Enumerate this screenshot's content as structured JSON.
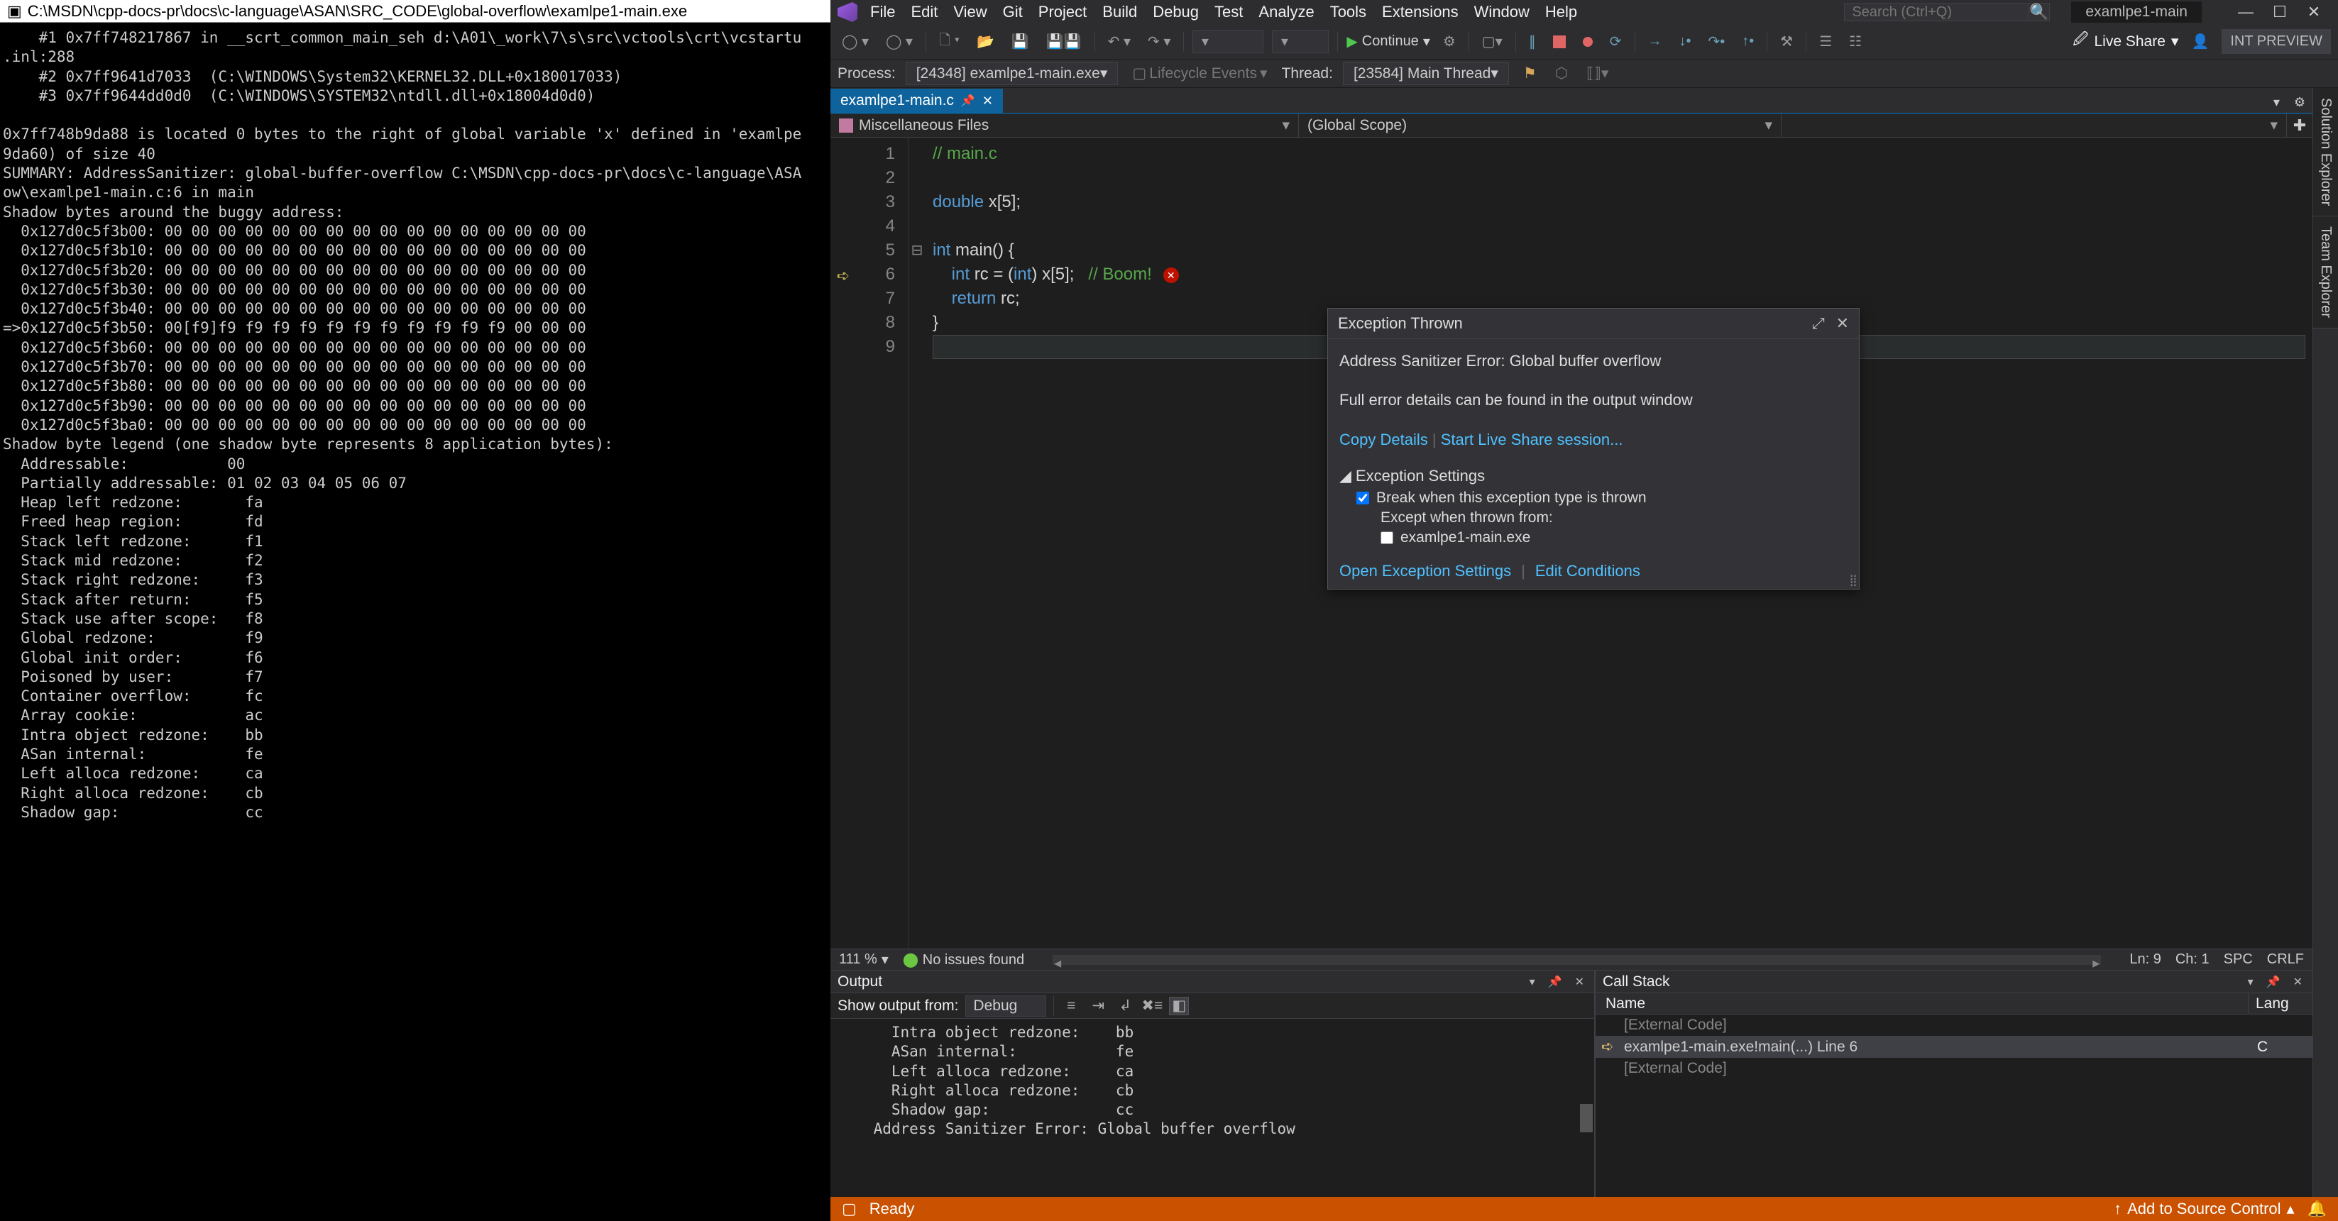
{
  "console": {
    "title": " C:\\MSDN\\cpp-docs-pr\\docs\\c-language\\ASAN\\SRC_CODE\\global-overflow\\examlpe1-main.exe",
    "body": "    #1 0x7ff748217867 in __scrt_common_main_seh d:\\A01\\_work\\7\\s\\src\\vctools\\crt\\vcstartu\n.inl:288\n    #2 0x7ff9641d7033  (C:\\WINDOWS\\System32\\KERNEL32.DLL+0x180017033)\n    #3 0x7ff9644dd0d0  (C:\\WINDOWS\\SYSTEM32\\ntdll.dll+0x18004d0d0)\n\n0x7ff748b9da88 is located 0 bytes to the right of global variable 'x' defined in 'examlpe\n9da60) of size 40\nSUMMARY: AddressSanitizer: global-buffer-overflow C:\\MSDN\\cpp-docs-pr\\docs\\c-language\\ASA\now\\examlpe1-main.c:6 in main\nShadow bytes around the buggy address:\n  0x127d0c5f3b00: 00 00 00 00 00 00 00 00 00 00 00 00 00 00 00 00\n  0x127d0c5f3b10: 00 00 00 00 00 00 00 00 00 00 00 00 00 00 00 00\n  0x127d0c5f3b20: 00 00 00 00 00 00 00 00 00 00 00 00 00 00 00 00\n  0x127d0c5f3b30: 00 00 00 00 00 00 00 00 00 00 00 00 00 00 00 00\n  0x127d0c5f3b40: 00 00 00 00 00 00 00 00 00 00 00 00 00 00 00 00\n=>0x127d0c5f3b50: 00[f9]f9 f9 f9 f9 f9 f9 f9 f9 f9 f9 f9 00 00 00\n  0x127d0c5f3b60: 00 00 00 00 00 00 00 00 00 00 00 00 00 00 00 00\n  0x127d0c5f3b70: 00 00 00 00 00 00 00 00 00 00 00 00 00 00 00 00\n  0x127d0c5f3b80: 00 00 00 00 00 00 00 00 00 00 00 00 00 00 00 00\n  0x127d0c5f3b90: 00 00 00 00 00 00 00 00 00 00 00 00 00 00 00 00\n  0x127d0c5f3ba0: 00 00 00 00 00 00 00 00 00 00 00 00 00 00 00 00\nShadow byte legend (one shadow byte represents 8 application bytes):\n  Addressable:           00\n  Partially addressable: 01 02 03 04 05 06 07\n  Heap left redzone:       fa\n  Freed heap region:       fd\n  Stack left redzone:      f1\n  Stack mid redzone:       f2\n  Stack right redzone:     f3\n  Stack after return:      f5\n  Stack use after scope:   f8\n  Global redzone:          f9\n  Global init order:       f6\n  Poisoned by user:        f7\n  Container overflow:      fc\n  Array cookie:            ac\n  Intra object redzone:    bb\n  ASan internal:           fe\n  Left alloca redzone:     ca\n  Right alloca redzone:    cb\n  Shadow gap:              cc"
  },
  "menu": {
    "items": [
      "File",
      "Edit",
      "View",
      "Git",
      "Project",
      "Build",
      "Debug",
      "Test",
      "Analyze",
      "Tools",
      "Extensions",
      "Window",
      "Help"
    ]
  },
  "search": {
    "placeholder": "Search (Ctrl+Q)"
  },
  "solution_name": "examlpe1-main",
  "toolbar": {
    "continue": "Continue",
    "live_share": "Live Share",
    "int_preview": "INT PREVIEW"
  },
  "procbar": {
    "process_label": "Process:",
    "process_value": "[24348] examlpe1-main.exe",
    "lifecycle": "Lifecycle Events",
    "thread_label": "Thread:",
    "thread_value": "[23584] Main Thread"
  },
  "file_tab": {
    "name": "examlpe1-main.c"
  },
  "navbar": {
    "left": "Miscellaneous Files",
    "middle": "(Global Scope)",
    "right": ""
  },
  "code": {
    "lines": [
      {
        "n": 1,
        "html": "<span class='cm'>// main.c</span>"
      },
      {
        "n": 2,
        "html": ""
      },
      {
        "n": 3,
        "html": "<span class='kw'>double</span> x[5];"
      },
      {
        "n": 4,
        "html": ""
      },
      {
        "n": 5,
        "html": "<span class='kw'>int</span> main() {",
        "fold": "⊟"
      },
      {
        "n": 6,
        "html": "    <span class='kw'>int</span> rc = (<span class='kw'>int</span>) x[5];   <span class='cm'>// Boom!</span>",
        "err": true
      },
      {
        "n": 7,
        "html": "    <span class='kw'>return</span> rc;"
      },
      {
        "n": 8,
        "html": "}"
      },
      {
        "n": 9,
        "html": "",
        "cur": true
      }
    ]
  },
  "exception": {
    "title": "Exception Thrown",
    "message": "Address Sanitizer Error: Global buffer overflow",
    "details_note": "Full error details can be found in the output window",
    "copy": "Copy Details",
    "start_live": "Start Live Share session...",
    "settings_header": "Exception Settings",
    "break_label": "Break when this exception type is thrown",
    "except_label": "Except when thrown from:",
    "except_item": "examlpe1-main.exe",
    "open_settings": "Open Exception Settings",
    "edit_cond": "Edit Conditions"
  },
  "edit_status": {
    "zoom": "111 %",
    "issues": "No issues found",
    "ln": "Ln: 9",
    "ch": "Ch: 1",
    "spc": "SPC",
    "crlf": "CRLF"
  },
  "output": {
    "title": "Output",
    "show_from": "Show output from:",
    "source": "Debug",
    "body": "      Intra object redzone:    bb\n      ASan internal:           fe\n      Left alloca redzone:     ca\n      Right alloca redzone:    cb\n      Shadow gap:              cc\n    Address Sanitizer Error: Global buffer overflow\n"
  },
  "callstack": {
    "title": "Call Stack",
    "col_name": "Name",
    "col_lang": "Lang",
    "rows": [
      {
        "name": "[External Code]",
        "lang": "",
        "dim": true
      },
      {
        "name": "examlpe1-main.exe!main(...) Line 6",
        "lang": "C",
        "sel": true,
        "arrow": true
      },
      {
        "name": "[External Code]",
        "lang": "",
        "dim": true
      }
    ]
  },
  "sidetabs": {
    "sol": "Solution Explorer",
    "team": "Team Explorer"
  },
  "statusbar": {
    "ready": "Ready",
    "add_src": "Add to Source Control"
  }
}
